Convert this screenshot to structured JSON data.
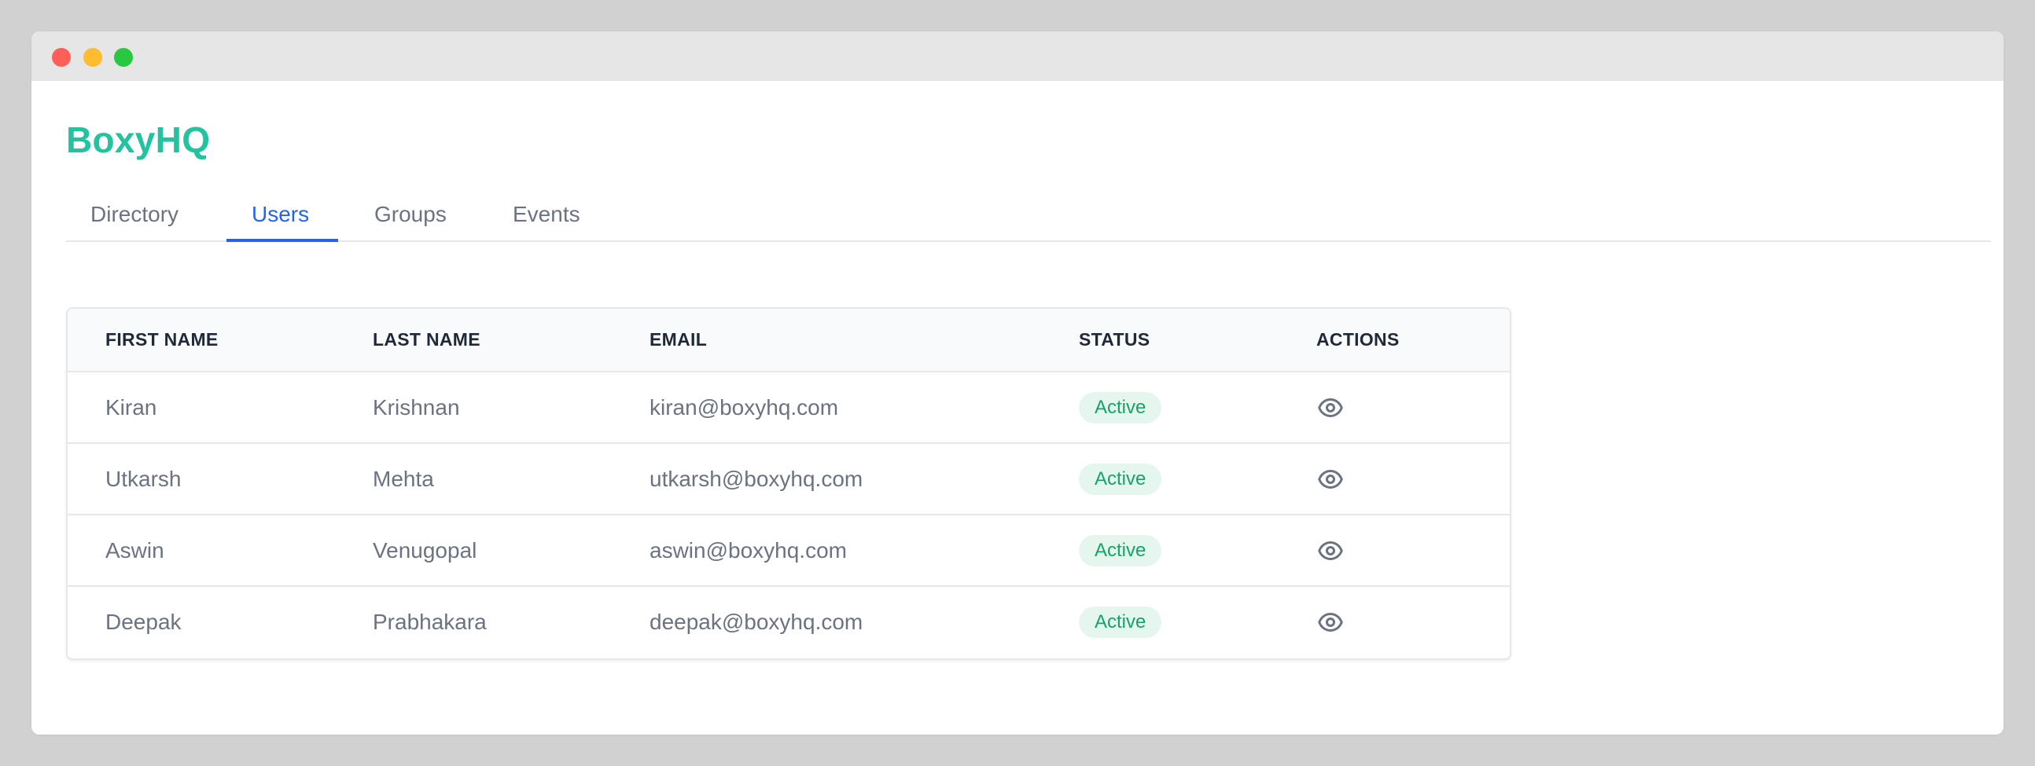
{
  "window": {
    "controls": [
      "close",
      "minimize",
      "maximize"
    ]
  },
  "brand": {
    "name": "BoxyHQ",
    "color": "#25c2a0"
  },
  "tabs": [
    {
      "label": "Directory",
      "active": false
    },
    {
      "label": "Users",
      "active": true
    },
    {
      "label": "Groups",
      "active": false
    },
    {
      "label": "Events",
      "active": false
    }
  ],
  "table": {
    "headers": {
      "first_name": "FIRST NAME",
      "last_name": "LAST NAME",
      "email": "EMAIL",
      "status": "STATUS",
      "actions": "ACTIONS"
    },
    "rows": [
      {
        "first_name": "Kiran",
        "last_name": "Krishnan",
        "email": "kiran@boxyhq.com",
        "status": "Active",
        "action_icon": "eye-icon"
      },
      {
        "first_name": "Utkarsh",
        "last_name": "Mehta",
        "email": "utkarsh@boxyhq.com",
        "status": "Active",
        "action_icon": "eye-icon"
      },
      {
        "first_name": "Aswin",
        "last_name": "Venugopal",
        "email": "aswin@boxyhq.com",
        "status": "Active",
        "action_icon": "eye-icon"
      },
      {
        "first_name": "Deepak",
        "last_name": "Prabhakara",
        "email": "deepak@boxyhq.com",
        "status": "Active",
        "action_icon": "eye-icon"
      }
    ]
  },
  "colors": {
    "accent": "#2563eb",
    "status_active_bg": "#e5f6ee",
    "status_active_text": "#16a36a"
  }
}
